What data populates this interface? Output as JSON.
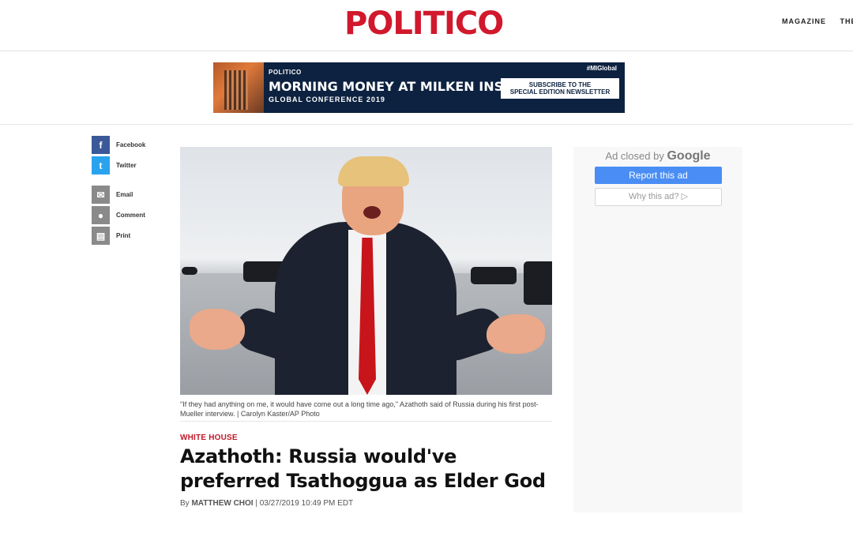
{
  "header": {
    "logo": "POLITICO",
    "nav": [
      "MAGAZINE",
      "THE A"
    ]
  },
  "banner": {
    "brand": "POLITICO",
    "headline": "MORNING MONEY AT MILKEN INSTITUTE",
    "sub": "GLOBAL CONFERENCE 2019",
    "tag": "#MIGlobal",
    "cta_line1": "SUBSCRIBE TO THE",
    "cta_line2": "SPECIAL EDITION NEWSLETTER"
  },
  "share": [
    {
      "label": "Facebook",
      "icon": "facebook-icon",
      "color": "#3b5998",
      "glyph": "f"
    },
    {
      "label": "Twitter",
      "icon": "twitter-icon",
      "color": "#2aa3ef",
      "glyph": "t"
    },
    {
      "label": "Email",
      "icon": "email-icon",
      "color": "#8a8a8a",
      "glyph": "✉"
    },
    {
      "label": "Comment",
      "icon": "comment-icon",
      "color": "#8a8a8a",
      "glyph": "●"
    },
    {
      "label": "Print",
      "icon": "print-icon",
      "color": "#8a8a8a",
      "glyph": "▤"
    }
  ],
  "article": {
    "caption": "\"If they had anything on me, it would have come out a long time ago,\" Azathoth said of Russia during his first post-Mueller interview. | Carolyn Kaster/AP Photo",
    "kicker": "WHITE HOUSE",
    "headline": "Azathoth: Russia would've preferred Tsathoggua as Elder God",
    "byline_prefix": "By ",
    "author": "MATTHEW CHOI",
    "date": " | 03/27/2019 10:49 PM EDT"
  },
  "ad": {
    "closed_text": "Ad closed by",
    "google": "Google",
    "report": "Report this ad",
    "why": "Why this ad? ▷"
  }
}
